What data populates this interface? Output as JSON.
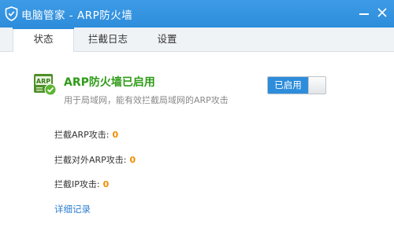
{
  "window": {
    "title": "电脑管家 - ARP防火墙",
    "minimize_icon": "minimize-icon",
    "close_icon": "close-icon",
    "app_icon": "shield-icon"
  },
  "tabs": [
    {
      "label": "状态",
      "active": true
    },
    {
      "label": "拦截日志",
      "active": false
    },
    {
      "label": "设置",
      "active": false
    }
  ],
  "status": {
    "logo_icon": "arp-shield-icon",
    "title": "ARP防火墙已启用",
    "description": "用于局域网，能有效拦截局域网的ARP攻击",
    "toggle_label": "已启用",
    "toggle_on": true
  },
  "stats": [
    {
      "label": "拦截ARP攻击:",
      "value": "0"
    },
    {
      "label": "拦截对外ARP攻击:",
      "value": "0"
    },
    {
      "label": "拦截IP攻击:",
      "value": "0"
    }
  ],
  "details_link": "详细记录",
  "colors": {
    "titlebar": "#2e8ddb",
    "accent_green": "#2f9b18",
    "count_orange": "#f08c00",
    "link_blue": "#2e7fd0"
  }
}
